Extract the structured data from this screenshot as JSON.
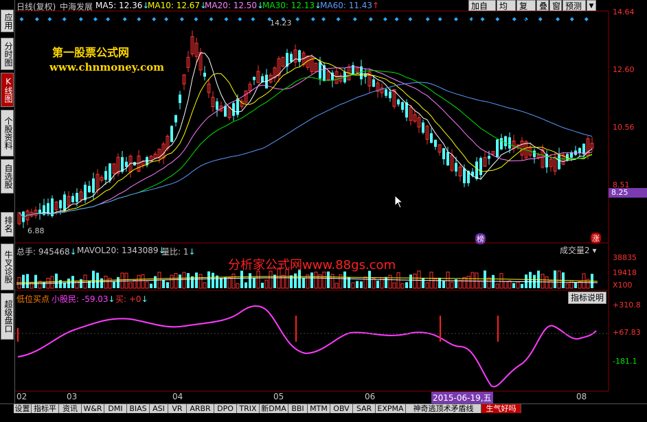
{
  "sidebar": {
    "items": [
      {
        "label": "应用"
      },
      {
        "label": "分时图"
      },
      {
        "label": "K线图"
      },
      {
        "label": "个股资料"
      },
      {
        "label": "自选股"
      },
      {
        "label": "排名"
      },
      {
        "label": "牛叉诊股"
      },
      {
        "label": "超级盘口"
      }
    ]
  },
  "header": {
    "period": "日线(复权)",
    "stock_name": "中海发展",
    "ma5": "MA5: 12.36",
    "ma10": "MA10: 12.67",
    "ma20": "MA20: 12.50",
    "ma30": "MA30: 12.13",
    "ma60": "MA60: 11.43"
  },
  "toolbar": {
    "add_watch": "加自选",
    "ma_line": "均线",
    "restore": "复权",
    "overlay": "叠",
    "window": "窗",
    "forecast": "预测"
  },
  "price_axis": [
    "14.64",
    "12.60",
    "10.56",
    "8.51",
    "8.25"
  ],
  "annotations": {
    "high": "14.23",
    "low": "6.88",
    "bang": "榜",
    "zhang": "涨"
  },
  "watermark": {
    "title": "第一股票公式网",
    "url": "www.chnmoney.com",
    "vol_watermark": "分析家公式网www.88gs.com"
  },
  "volume_panel": {
    "total": "总手: 945468",
    "mavol": "MAVOL20: 1343089",
    "ratio": "量比: 1",
    "selector": "成交量2",
    "axis": [
      "38835",
      "19418",
      "X100"
    ]
  },
  "indicator_panel": {
    "name": "低位买点",
    "xiaogumin": "小股民: -59.03",
    "buy": "买: +0",
    "help": "指标说明",
    "axis": [
      "+310.8",
      "+67.83",
      "-181.1"
    ]
  },
  "x_axis": [
    "02",
    "03",
    "04",
    "05",
    "06",
    "2015-06-19,五",
    "08"
  ],
  "bottom_tabs": [
    "设置",
    "指标平台",
    "资讯",
    "W&R",
    "DMI",
    "BIAS",
    "ASI",
    "VR",
    "ARBR",
    "DPO",
    "TRIX",
    "新DMA",
    "BBI",
    "MTM",
    "OBV",
    "SAR",
    "EXPMA",
    "神奇逃顶术矛盾线",
    "生气好吗"
  ],
  "colors": {
    "up": "#ff3232",
    "down": "#54ffff",
    "ma5": "#ffffff",
    "ma10": "#ffff00",
    "ma20": "#ff80ff",
    "ma30": "#00e600",
    "ma60": "#5a9bff",
    "indicator": "#ff3cff"
  }
}
